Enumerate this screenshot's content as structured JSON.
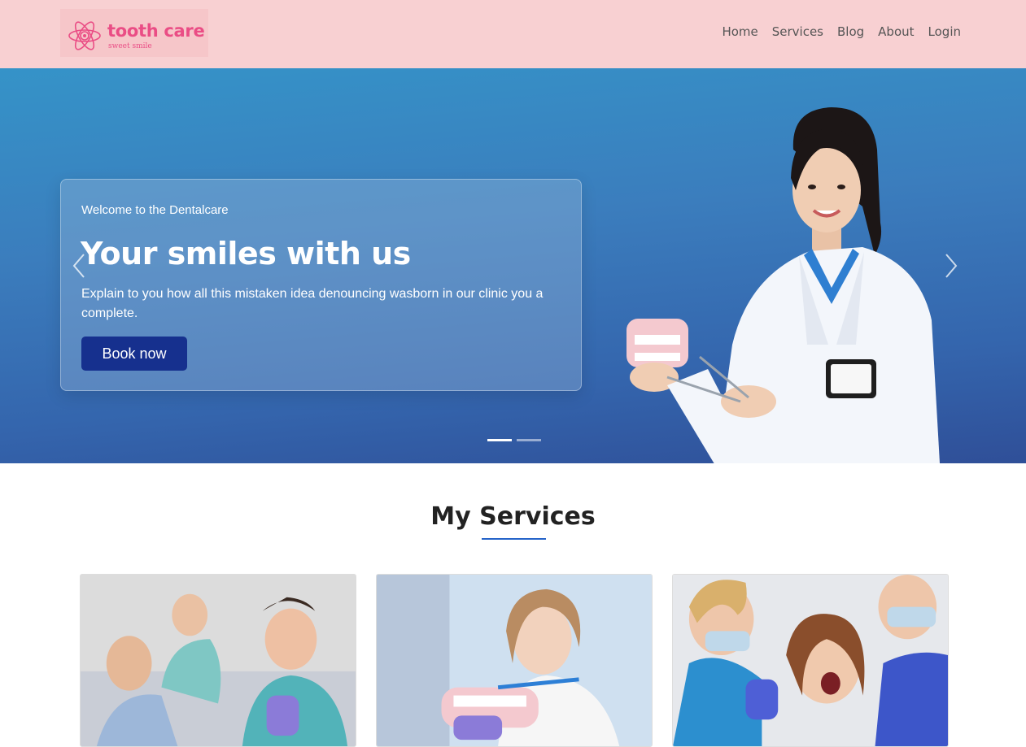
{
  "header": {
    "logo": {
      "title": "tooth care",
      "tagline": "sweet smile"
    },
    "nav": [
      {
        "label": "Home"
      },
      {
        "label": "Services"
      },
      {
        "label": "Blog"
      },
      {
        "label": "About"
      },
      {
        "label": "Login"
      }
    ]
  },
  "hero": {
    "kicker": "Welcome to the Dentalcare",
    "title": "Your smiles with us",
    "text": "Explain to you how all this mistaken idea denouncing wasborn in our clinic you a complete.",
    "button_label": "Book now",
    "slides": {
      "count": 2,
      "active": 1
    },
    "icons": {
      "prev": "chevron-left-icon",
      "next": "chevron-right-icon"
    }
  },
  "services": {
    "title": "My Services",
    "cards": [
      {
        "image": "dental-checkup-photo"
      },
      {
        "image": "child-brushing-model-photo"
      },
      {
        "image": "dental-treatment-photo"
      }
    ]
  },
  "colors": {
    "header_bg": "#f8d0d2",
    "brand_pink": "#ea4d85",
    "hero_blue": "#3b7dbd",
    "button_navy": "#16308e",
    "accent_underline": "#2563c9"
  }
}
